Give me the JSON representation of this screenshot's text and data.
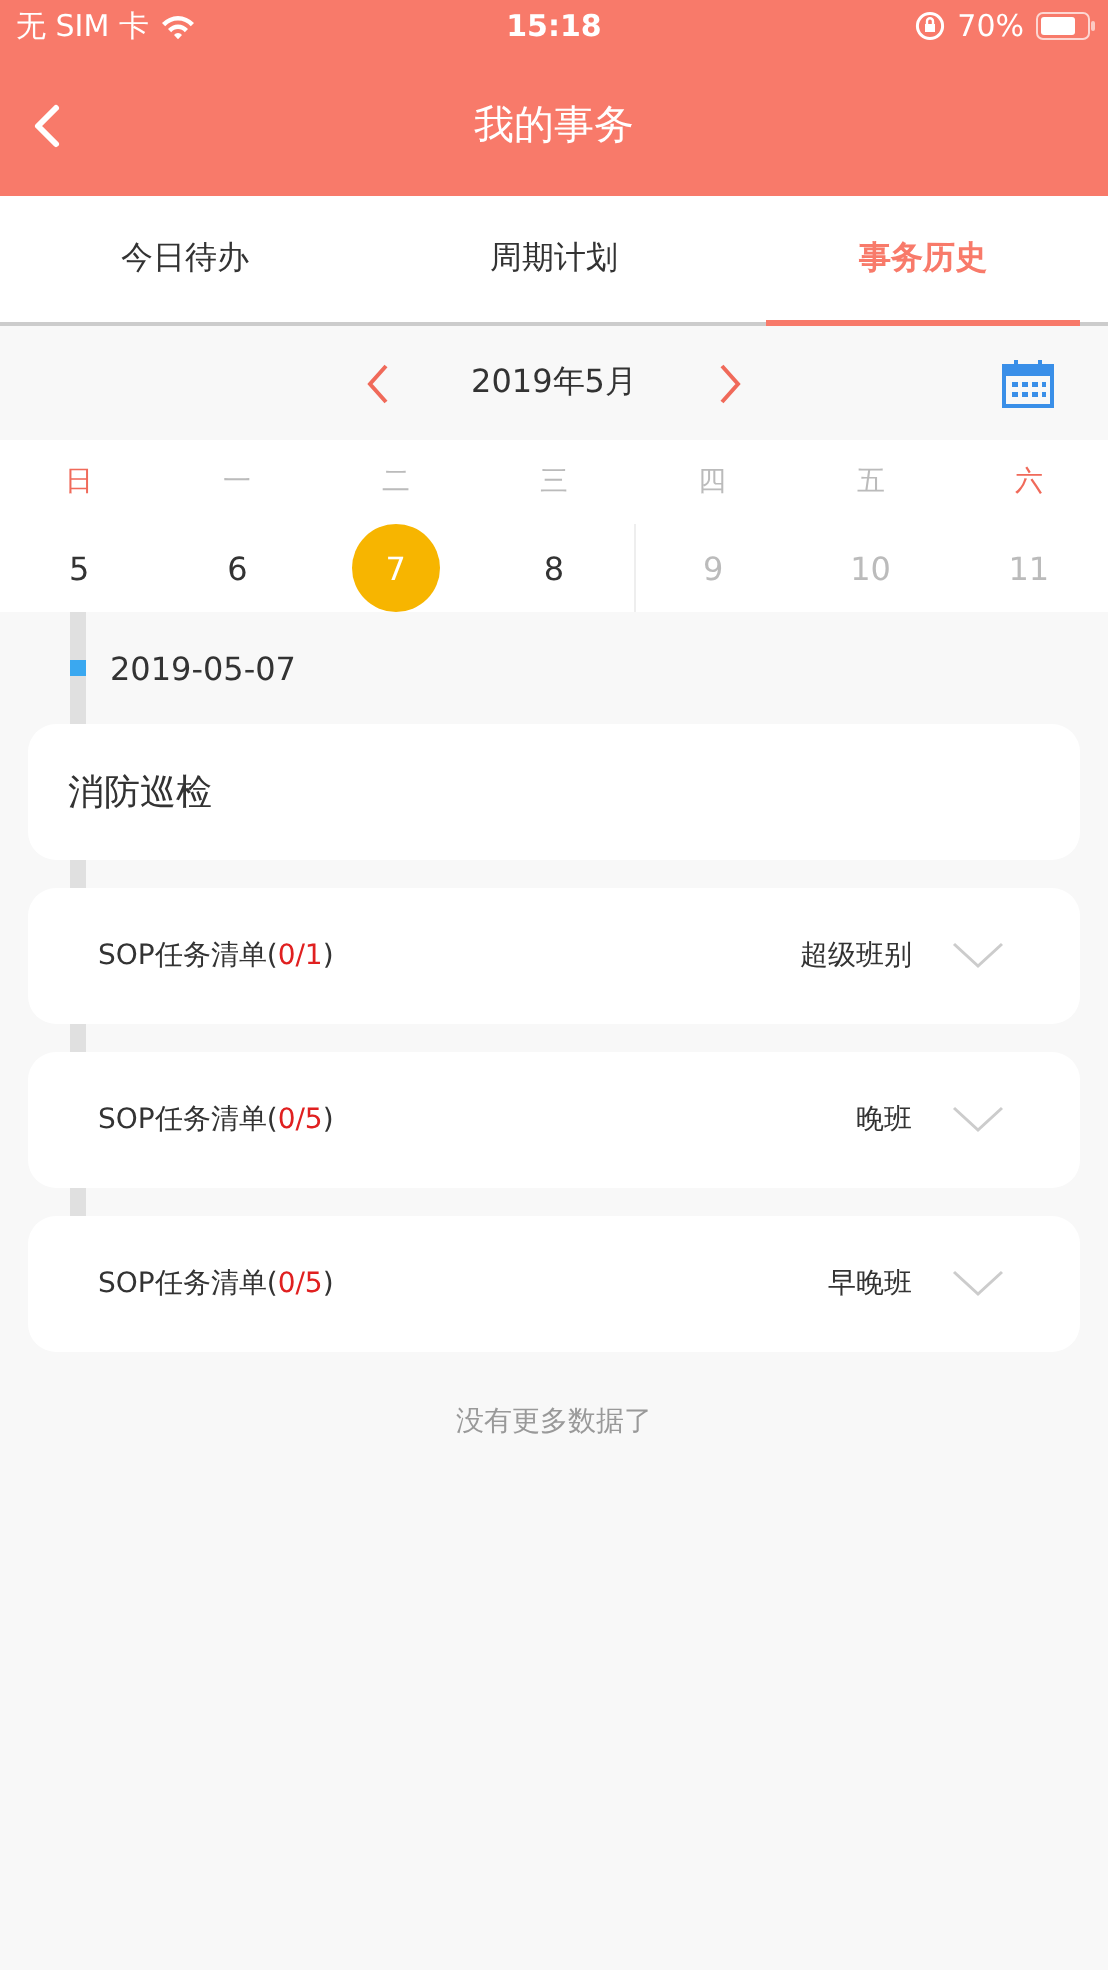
{
  "status_bar": {
    "carrier": "无 SIM 卡",
    "time": "15:18",
    "battery": "70%"
  },
  "nav": {
    "title": "我的事务"
  },
  "tabs": [
    {
      "label": "今日待办",
      "selected": false
    },
    {
      "label": "周期计划",
      "selected": false
    },
    {
      "label": "事务历史",
      "selected": true
    }
  ],
  "calendar": {
    "month": "2019年5月",
    "weekdays": [
      {
        "label": "日",
        "weekend": true
      },
      {
        "label": "一",
        "weekend": false
      },
      {
        "label": "二",
        "weekend": false
      },
      {
        "label": "三",
        "weekend": false
      },
      {
        "label": "四",
        "weekend": false
      },
      {
        "label": "五",
        "weekend": false
      },
      {
        "label": "六",
        "weekend": true
      }
    ],
    "dates": [
      {
        "label": "5",
        "selected": false,
        "disabled": false
      },
      {
        "label": "6",
        "selected": false,
        "disabled": false
      },
      {
        "label": "7",
        "selected": true,
        "disabled": false
      },
      {
        "label": "8",
        "selected": false,
        "disabled": false
      },
      {
        "label": "9",
        "selected": false,
        "disabled": true
      },
      {
        "label": "10",
        "selected": false,
        "disabled": true
      },
      {
        "label": "11",
        "selected": false,
        "disabled": true
      }
    ]
  },
  "history": {
    "date": "2019-05-07",
    "items": [
      {
        "kind": "title",
        "title": "消防巡检"
      },
      {
        "kind": "checklist",
        "prefix": "SOP任务清单(",
        "count": "0/1",
        "suffix": ")",
        "shift": "超级班别",
        "expanded": false
      },
      {
        "kind": "checklist",
        "prefix": "SOP任务清单(",
        "count": "0/5",
        "suffix": ")",
        "shift": "晚班",
        "expanded": false
      },
      {
        "kind": "checklist",
        "prefix": "SOP任务清单(",
        "count": "0/5",
        "suffix": ")",
        "shift": "早晚班",
        "expanded": false
      }
    ]
  },
  "footer": "没有更多数据了"
}
